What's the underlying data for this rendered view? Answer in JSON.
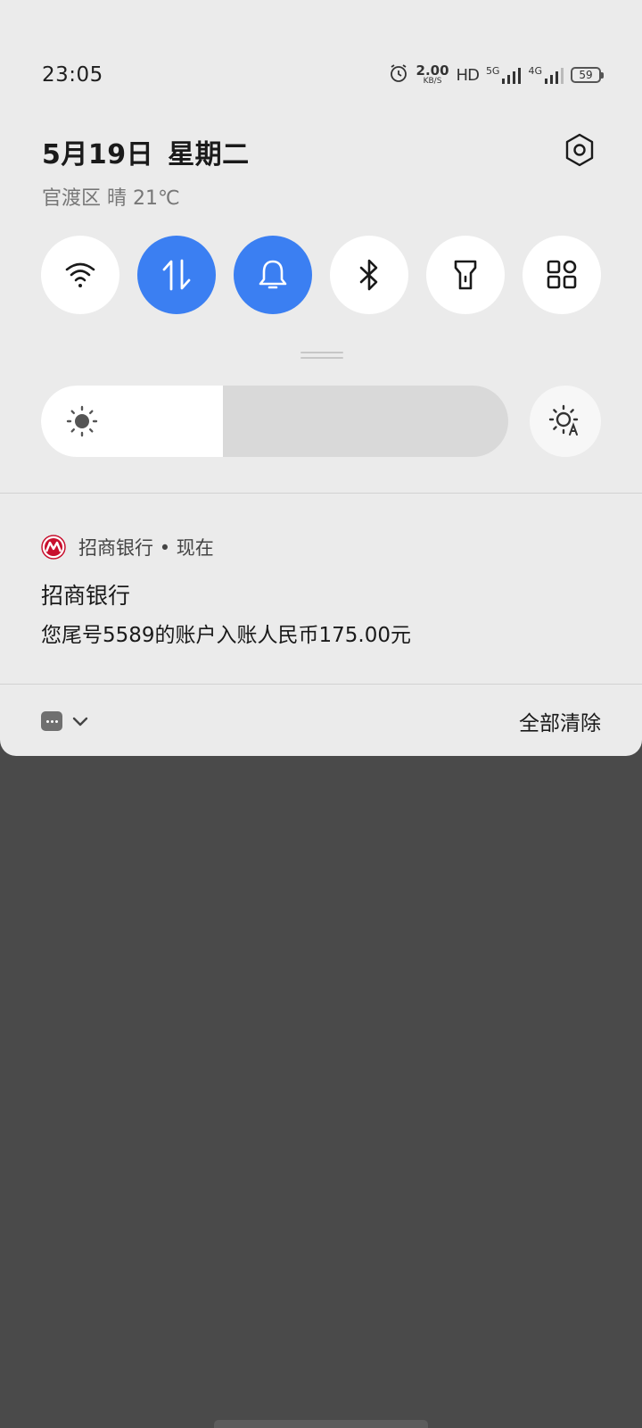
{
  "status_bar": {
    "time": "23:05",
    "net_speed_value": "2.00",
    "net_speed_unit": "KB/S",
    "hd_label": "HD",
    "net_5g": "5G",
    "net_4g": "4G",
    "battery_level": "59"
  },
  "header": {
    "date": "5月19日",
    "weekday": "星期二",
    "weather": "官渡区 晴 21℃"
  },
  "quick_toggles": [
    {
      "name": "wifi",
      "active": false
    },
    {
      "name": "mobile-data",
      "active": true
    },
    {
      "name": "sound",
      "active": true
    },
    {
      "name": "bluetooth",
      "active": false
    },
    {
      "name": "flashlight",
      "active": false
    },
    {
      "name": "more-tiles",
      "active": false
    }
  ],
  "brightness": {
    "level_percent": 39
  },
  "notification": {
    "app_name": "招商银行",
    "time": "现在",
    "title": "招商银行",
    "body": "您尾号5589的账户入账人民币175.00元",
    "brand_color": "#c8102e"
  },
  "footer": {
    "clear_all_label": "全部清除"
  },
  "colors": {
    "accent": "#3b7ff2",
    "panel_bg": "#ebebeb",
    "scrim": "#4a4a4a"
  }
}
